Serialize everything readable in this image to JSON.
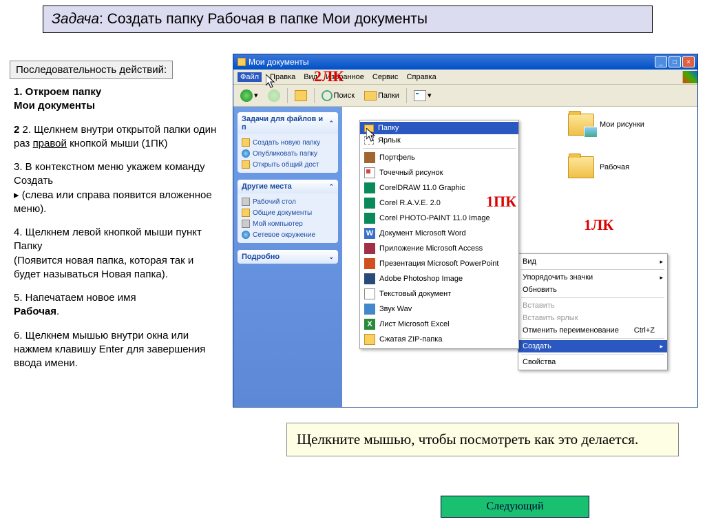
{
  "task": {
    "prefix": "Задача",
    "text": ": Создать папку Рабочая в папке Мои документы"
  },
  "seq_label": "Последовательность действий:",
  "steps": {
    "s1a": "1. Откроем папку",
    "s1b": "Мои документы",
    "s2a": "2. Щелкнем внутри открытой папки один раз ",
    "s2b": "правой",
    "s2c": " кнопкой мыши (1ПК)",
    "s3a": "3. В контекстном меню укажем  команду ",
    "s3b": "Создать",
    "s3c": "▸  (слева или справа появится вложенное меню).",
    "s4a": "4. Щелкнем левой кнопкой мыши пункт ",
    "s4b": "Папку",
    "s4c": "(Появится новая папка, которая так и будет называться Новая папка).",
    "s5a": "5. Напечатаем новое имя ",
    "s5b": "Рабочая",
    "s6": "6. Щелкнем мышью внутри окна или нажмем клавишу Enter для завершения ввода имени."
  },
  "explorer": {
    "title": "Мои документы",
    "menus": [
      "Файл",
      "Правка",
      "Вид",
      "Избранное",
      "Сервис",
      "Справка"
    ],
    "toolbar": {
      "search": "Поиск",
      "folders": "Папки"
    },
    "side": {
      "tasks_hd": "Задачи для файлов и п",
      "tasks": [
        "Создать новую папку",
        "Опубликовать папку",
        "Открыть общий дост"
      ],
      "places_hd": "Другие места",
      "places": [
        "Рабочий стол",
        "Общие документы",
        "Мой компьютер",
        "Сетевое окружение"
      ],
      "detail_hd": "Подробно"
    },
    "folders": {
      "pics": "Мои рисунки",
      "work": "Рабочая"
    }
  },
  "annotations": {
    "a2lk": "2ЛК",
    "a1pk": "1ПК",
    "a1lk": "1ЛК"
  },
  "submenu": [
    {
      "label": "Папку",
      "icon": "ic-folder",
      "selected": true
    },
    {
      "label": "Ярлык",
      "icon": "ic-short"
    },
    {
      "sep": true
    },
    {
      "label": "Портфель",
      "icon": "ic-brief"
    },
    {
      "label": "Точечный рисунок",
      "icon": "ic-bmp"
    },
    {
      "label": "CorelDRAW 11.0 Graphic",
      "icon": "ic-cdr"
    },
    {
      "label": "Corel R.A.V.E. 2.0",
      "icon": "ic-cdr"
    },
    {
      "label": "Corel PHOTO-PAINT 11.0 Image",
      "icon": "ic-cdr"
    },
    {
      "label": "Документ Microsoft Word",
      "icon": "ic-word",
      "glyph": "W"
    },
    {
      "label": "Приложение Microsoft Access",
      "icon": "ic-acc"
    },
    {
      "label": "Презентация Microsoft PowerPoint",
      "icon": "ic-ppt"
    },
    {
      "label": "Adobe Photoshop Image",
      "icon": "ic-ps"
    },
    {
      "label": "Текстовый документ",
      "icon": "ic-txt"
    },
    {
      "label": "Звук Wav",
      "icon": "ic-wav"
    },
    {
      "label": "Лист Microsoft Excel",
      "icon": "ic-xls",
      "glyph": "X"
    },
    {
      "label": "Сжатая ZIP-папка",
      "icon": "ic-zip"
    }
  ],
  "context_menu": [
    {
      "label": "Вид",
      "sub": true
    },
    {
      "sep": true
    },
    {
      "label": "Упорядочить значки",
      "sub": true
    },
    {
      "label": "Обновить"
    },
    {
      "sep": true
    },
    {
      "label": "Вставить",
      "disabled": true
    },
    {
      "label": "Вставить ярлык",
      "disabled": true
    },
    {
      "label": "Отменить переименование",
      "shortcut": "Ctrl+Z"
    },
    {
      "sep": true
    },
    {
      "label": "Создать",
      "sub": true,
      "selected": true
    },
    {
      "sep": true
    },
    {
      "label": "Свойства"
    }
  ],
  "instruction": "Щелкните мышью, чтобы посмотреть как это делается.",
  "next": "Следующий"
}
